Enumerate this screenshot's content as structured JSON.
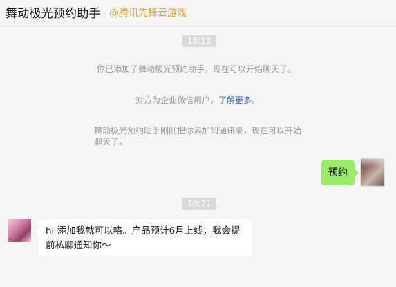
{
  "header": {
    "title": "舞动极光预约助手",
    "org": "@腾讯先锋云游戏"
  },
  "messages": {
    "time1": "18:12",
    "sys1": "你已添加了舞动极光预约助手，现在可以开始聊天了。",
    "sys2_prefix": "对方为企业微信用户，",
    "sys2_link": "了解更多。",
    "sys3_line1": "舞动极光预约助手刚刚把你添加到通讯录，现在可以开始",
    "sys3_line2": "聊天了。",
    "outgoing": "预约",
    "time2": "18:31",
    "incoming_line1": "hi 添加我就可以咯。产品预计6月上线，我会提",
    "incoming_line2": "前私聊通知你～"
  },
  "colors": {
    "org": "#e8a23b",
    "bubble_out": "#9bea6a",
    "link": "#3a64b5"
  }
}
